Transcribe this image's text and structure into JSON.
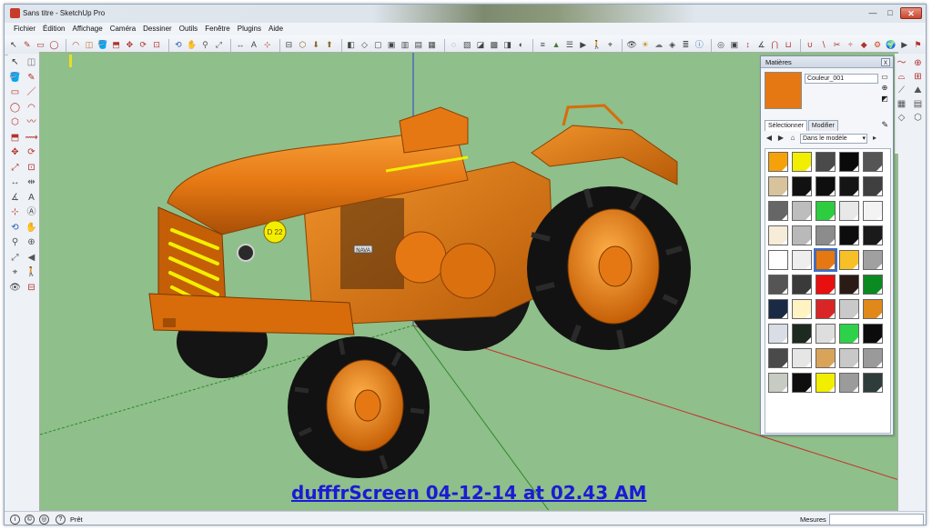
{
  "window": {
    "title": "Sans titre - SketchUp Pro",
    "controls": [
      "minimize",
      "maximize",
      "close"
    ]
  },
  "menu": {
    "items": [
      "Fichier",
      "Édition",
      "Affichage",
      "Caméra",
      "Dessiner",
      "Outils",
      "Fenêtre",
      "Plugins",
      "Aide"
    ]
  },
  "toolbar": {
    "icons": [
      "select",
      "pencil",
      "rectangle",
      "circle",
      "arc",
      "eraser",
      "paint-bucket",
      "push-pull",
      "move",
      "rotate",
      "offset",
      "orbit",
      "pan",
      "zoom",
      "zoom-extents",
      "tape-measure",
      "text",
      "axes",
      "section-plane",
      "3d-warehouse",
      "get-models",
      "share-model",
      "components",
      "iso",
      "top",
      "front",
      "right",
      "back",
      "left",
      "xray",
      "wireframe",
      "hidden-line",
      "shaded",
      "shaded-textures",
      "monochrome",
      "display-edges",
      "sandbox",
      "layers",
      "scenes",
      "walk",
      "position-camera",
      "look-around",
      "shadows",
      "fog",
      "styles",
      "outliner",
      "instructor",
      "match-photo",
      "photo",
      "dimension",
      "protractor",
      "intersect",
      "outer-shell",
      "union",
      "subtract",
      "trim",
      "split",
      "solid-tools",
      "dynamic-components",
      "google-earth",
      "preview",
      "geo-location"
    ]
  },
  "left_tools": {
    "icons": [
      "select-arrow",
      "eraser",
      "paint-bucket",
      "pencil",
      "rectangle",
      "line",
      "circle",
      "arc",
      "polygon",
      "freehand",
      "push-pull",
      "follow-me",
      "move",
      "rotate",
      "scale",
      "offset",
      "tape-measure",
      "dimension",
      "protractor",
      "text",
      "axes",
      "3d-text",
      "orbit",
      "pan",
      "zoom",
      "zoom-window",
      "zoom-extents",
      "previous-view",
      "position-camera",
      "walk",
      "look-around",
      "section-plane"
    ]
  },
  "right_tools": {
    "icons": [
      "sandbox-smoove",
      "sandbox-stamp",
      "sandbox-drape",
      "sandbox-add-detail",
      "sandbox-flip-edge",
      "sandbox-from-contours",
      "sandbox-from-scratch",
      "sandbox-grid",
      "sandbox-layer",
      "sandbox-terrain"
    ]
  },
  "materials_panel": {
    "title": "Matières",
    "close_label": "x",
    "current_material": "Couleur_001",
    "current_color": "#e67813",
    "tabs": [
      "Sélectionner",
      "Modifier"
    ],
    "active_tab": "Sélectionner",
    "collection": "Dans le modèle",
    "swatches": [
      {
        "color": "#f5a20a"
      },
      {
        "color": "#f2ee00"
      },
      {
        "color": "#4a4a4a"
      },
      {
        "color": "#0a0a0a"
      },
      {
        "color": "#555555"
      },
      {
        "color": "#d8c39c"
      },
      {
        "color": "#111111"
      },
      {
        "color": "#0e0e0e"
      },
      {
        "color": "#151515"
      },
      {
        "color": "#3f3f3f"
      },
      {
        "color": "#666666"
      },
      {
        "color": "#bdbdbd"
      },
      {
        "color": "#2ecc3f"
      },
      {
        "color": "#e8e8e8"
      },
      {
        "color": "#f3f3f3"
      },
      {
        "color": "#f6ecd8"
      },
      {
        "color": "#b9b9b9"
      },
      {
        "color": "#8c8c8c"
      },
      {
        "color": "#0d0d0d"
      },
      {
        "color": "#1a1a1a"
      },
      {
        "color": "#ffffff"
      },
      {
        "color": "#eeeeee"
      },
      {
        "color": "#e67813"
      },
      {
        "color": "#f7c026"
      },
      {
        "color": "#a0a0a0"
      },
      {
        "color": "#555555"
      },
      {
        "color": "#3a3a3a"
      },
      {
        "color": "#e80f0f"
      },
      {
        "color": "#2b1b16"
      },
      {
        "color": "#0b8a22"
      },
      {
        "color": "#1a2a44"
      },
      {
        "color": "#fff3c4"
      },
      {
        "color": "#d92525"
      },
      {
        "color": "#c9c9c9"
      },
      {
        "color": "#e0891a"
      },
      {
        "color": "#d8dde6"
      },
      {
        "color": "#1d2a1f"
      },
      {
        "color": "#dedede"
      },
      {
        "color": "#2ed14a"
      },
      {
        "color": "#0c0c0c"
      },
      {
        "color": "#4a4a4a"
      },
      {
        "color": "#e6e6e6"
      },
      {
        "color": "#d9a45a"
      },
      {
        "color": "#c8c8c8"
      },
      {
        "color": "#9a9a9a"
      },
      {
        "color": "#c6ccc2"
      },
      {
        "color": "#0e0e0e"
      },
      {
        "color": "#f2ee00"
      },
      {
        "color": "#9b9b9b"
      },
      {
        "color": "#2f3d3a"
      }
    ],
    "selected_swatch_index": 22
  },
  "viewport": {
    "background": "#8fbf8a",
    "watermark": "dufffrScreen 04-12-14 at 02.43 AM",
    "badge_text": "D 22",
    "hood_plate": "NAVA"
  },
  "statusbar": {
    "status_text": "Prêt",
    "measure_label": "Mesures",
    "measure_value": ""
  },
  "colors": {
    "tractor_orange": "#e67813",
    "tire": "#151515",
    "axis_red": "#c53030",
    "axis_green": "#2a8a2a",
    "axis_blue": "#2b3fd0",
    "watermark": "#1b1bd4"
  }
}
